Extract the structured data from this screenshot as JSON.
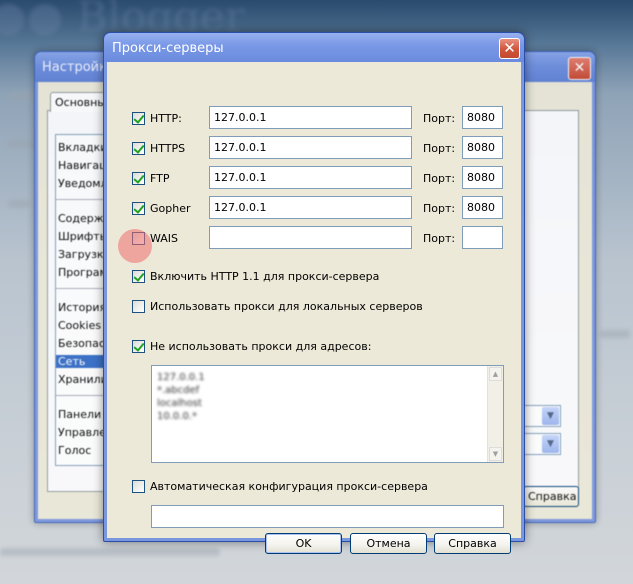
{
  "background_window": {
    "title": "Настройки",
    "tab_label": "Основные",
    "list_items": [
      "Вкладки",
      "Навигация",
      "Уведомления",
      "Содержимое",
      "Шрифты",
      "Загрузки",
      "Программы",
      "История",
      "Cookies",
      "Безопасность",
      "Сеть",
      "Хранилище",
      "Панели",
      "Управление",
      "Голос"
    ],
    "selected_item": "Сеть",
    "help_label": "Справка"
  },
  "dialog": {
    "title": "Прокси-серверы",
    "port_label": "Порт:",
    "proxies": [
      {
        "label": "HTTP:",
        "checked": true,
        "host": "127.0.0.1",
        "port": "8080"
      },
      {
        "label": "HTTPS",
        "checked": true,
        "host": "127.0.0.1",
        "port": "8080"
      },
      {
        "label": "FTP",
        "checked": true,
        "host": "127.0.0.1",
        "port": "8080"
      },
      {
        "label": "Gopher",
        "checked": true,
        "host": "127.0.0.1",
        "port": "8080"
      },
      {
        "label": "WAIS",
        "checked": false,
        "host": "",
        "port": ""
      }
    ],
    "http11": {
      "label": "Включить HTTP 1.1 для прокси-сервера",
      "checked": true
    },
    "local": {
      "label": "Использовать прокси для локальных серверов",
      "checked": false
    },
    "bypass": {
      "label": "Не использовать прокси для адресов:",
      "checked": true
    },
    "bypass_list": [
      "127.0.0.1",
      "*.abcdef",
      "localhost",
      "10.0.0.*"
    ],
    "auto": {
      "label": "Автоматическая конфигурация прокси-сервера",
      "checked": false,
      "url": ""
    },
    "buttons": {
      "ok": "OK",
      "cancel": "Отмена",
      "help": "Справка"
    }
  }
}
